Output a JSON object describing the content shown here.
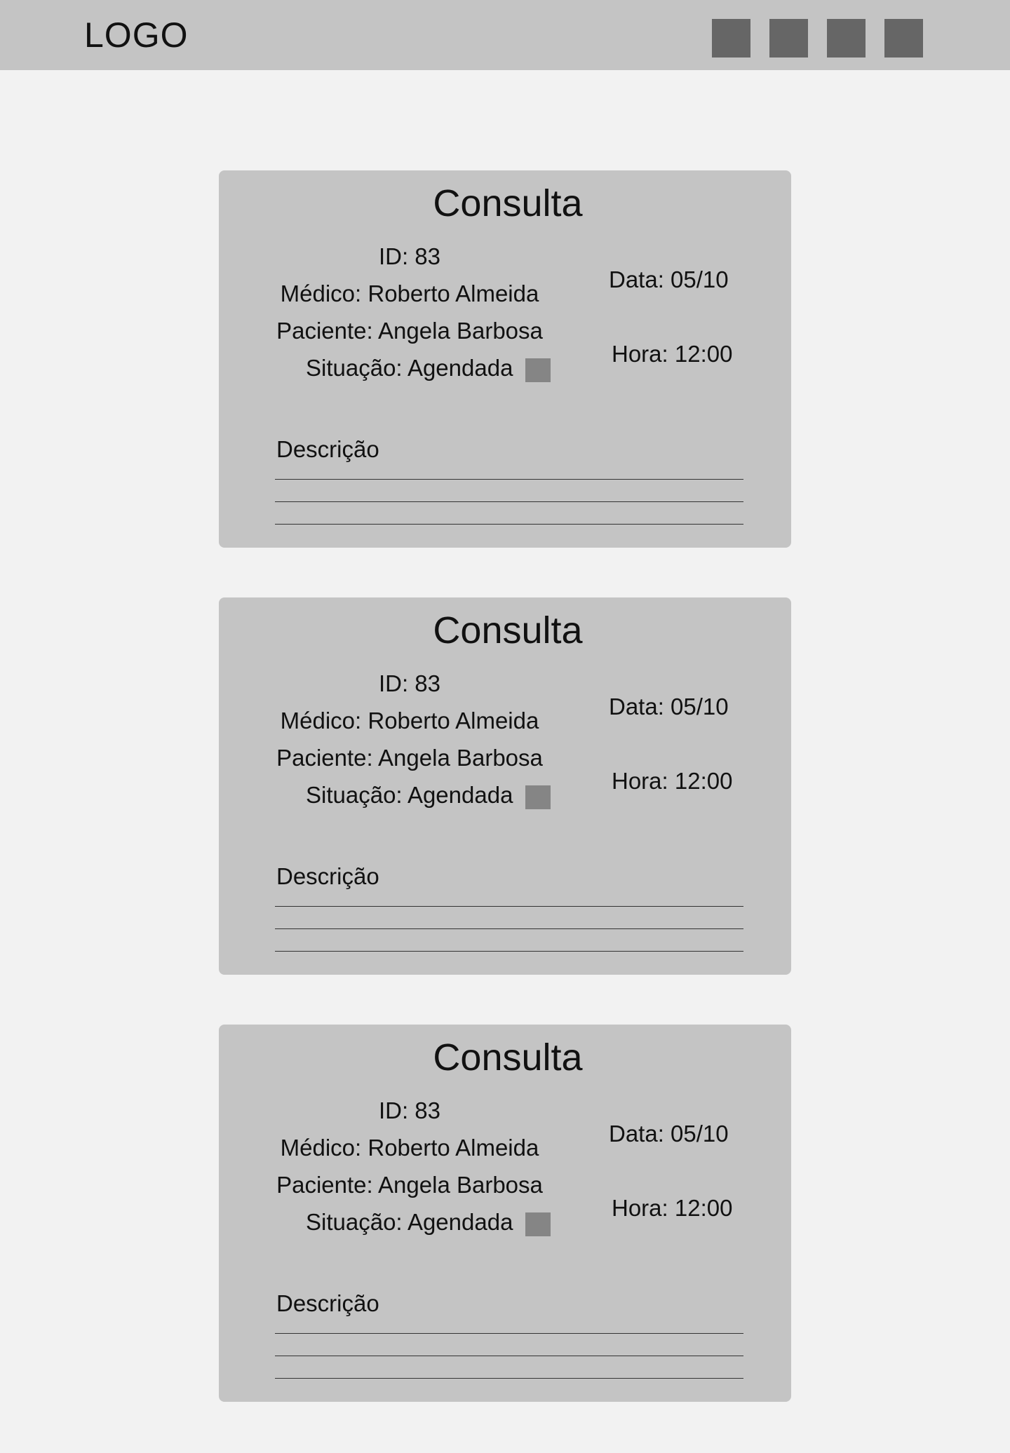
{
  "header": {
    "logo": "LOGO",
    "nav_buttons": [
      "nav-button-1",
      "nav-button-2",
      "nav-button-3",
      "nav-button-4"
    ]
  },
  "colors": {
    "background": "#f2f2f2",
    "panel": "#c4c4c4",
    "button": "#666666",
    "status_indicator": "#858585"
  },
  "cards": [
    {
      "title": "Consulta",
      "id": "ID: 83",
      "medico": "Médico: Roberto Almeida",
      "paciente": "Paciente: Angela Barbosa",
      "situacao": "Situação: Agendada",
      "data": "Data: 05/10",
      "hora": "Hora: 12:00",
      "descricao_label": "Descrição"
    },
    {
      "title": "Consulta",
      "id": "ID: 83",
      "medico": "Médico: Roberto Almeida",
      "paciente": "Paciente: Angela Barbosa",
      "situacao": "Situação: Agendada",
      "data": "Data: 05/10",
      "hora": "Hora: 12:00",
      "descricao_label": "Descrição"
    },
    {
      "title": "Consulta",
      "id": "ID: 83",
      "medico": "Médico: Roberto Almeida",
      "paciente": "Paciente: Angela Barbosa",
      "situacao": "Situação: Agendada",
      "data": "Data: 05/10",
      "hora": "Hora: 12:00",
      "descricao_label": "Descrição"
    }
  ]
}
